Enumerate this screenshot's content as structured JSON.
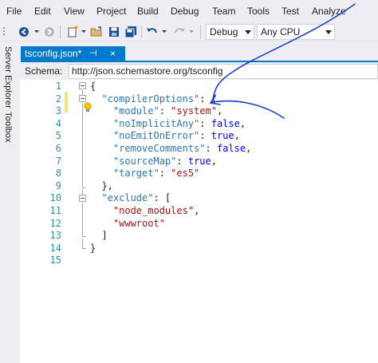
{
  "menu": [
    "File",
    "Edit",
    "View",
    "Project",
    "Build",
    "Debug",
    "Team",
    "Tools",
    "Test",
    "Analyze"
  ],
  "toolbar": {
    "config_value": "Debug",
    "platform_value": "Any CPU"
  },
  "side_tabs": [
    "Server Explorer",
    "Toolbox"
  ],
  "tab": {
    "title": "tsconfig.json*",
    "pin_glyph": "⊣",
    "close_glyph": "×"
  },
  "schema": {
    "label": "Schema:",
    "url": "http://json.schemastore.org/tsconfig"
  },
  "editor": {
    "line_numbers": [
      "1",
      "2",
      "3",
      "4",
      "5",
      "6",
      "7",
      "8",
      "9",
      "10",
      "11",
      "12",
      "13",
      "14",
      "15"
    ],
    "lines": [
      [
        {
          "t": "{",
          "c": "punc"
        }
      ],
      [
        {
          "t": "  ",
          "c": "punc"
        },
        {
          "t": "\"compilerOptions\"",
          "c": "key"
        },
        {
          "t": ": {",
          "c": "punc"
        }
      ],
      [
        {
          "t": "    ",
          "c": "punc"
        },
        {
          "t": "\"module\"",
          "c": "key"
        },
        {
          "t": ": ",
          "c": "punc"
        },
        {
          "t": "\"system\"",
          "c": "str"
        },
        {
          "t": ",",
          "c": "punc"
        }
      ],
      [
        {
          "t": "    ",
          "c": "punc"
        },
        {
          "t": "\"noImplicitAny\"",
          "c": "key"
        },
        {
          "t": ": ",
          "c": "punc"
        },
        {
          "t": "false",
          "c": "kw"
        },
        {
          "t": ",",
          "c": "punc"
        }
      ],
      [
        {
          "t": "    ",
          "c": "punc"
        },
        {
          "t": "\"noEmitOnError\"",
          "c": "key"
        },
        {
          "t": ": ",
          "c": "punc"
        },
        {
          "t": "true",
          "c": "kw"
        },
        {
          "t": ",",
          "c": "punc"
        }
      ],
      [
        {
          "t": "    ",
          "c": "punc"
        },
        {
          "t": "\"removeComments\"",
          "c": "key"
        },
        {
          "t": ": ",
          "c": "punc"
        },
        {
          "t": "false",
          "c": "kw"
        },
        {
          "t": ",",
          "c": "punc"
        }
      ],
      [
        {
          "t": "    ",
          "c": "punc"
        },
        {
          "t": "\"sourceMap\"",
          "c": "key"
        },
        {
          "t": ": ",
          "c": "punc"
        },
        {
          "t": "true",
          "c": "kw"
        },
        {
          "t": ",",
          "c": "punc"
        }
      ],
      [
        {
          "t": "    ",
          "c": "punc"
        },
        {
          "t": "\"target\"",
          "c": "key"
        },
        {
          "t": ": ",
          "c": "punc"
        },
        {
          "t": "\"es5\"",
          "c": "str"
        }
      ],
      [
        {
          "t": "  },",
          "c": "punc"
        }
      ],
      [
        {
          "t": "  ",
          "c": "punc"
        },
        {
          "t": "\"exclude\"",
          "c": "key"
        },
        {
          "t": ": [",
          "c": "punc"
        }
      ],
      [
        {
          "t": "    ",
          "c": "punc"
        },
        {
          "t": "\"node_modules\"",
          "c": "str"
        },
        {
          "t": ",",
          "c": "punc"
        }
      ],
      [
        {
          "t": "    ",
          "c": "punc"
        },
        {
          "t": "\"wwwroot\"",
          "c": "str"
        }
      ],
      [
        {
          "t": "  ]",
          "c": "punc"
        }
      ],
      [
        {
          "t": "}",
          "c": "punc"
        }
      ],
      []
    ]
  },
  "colors": {
    "accent": "#007acc",
    "chrome": "#eeeef2",
    "line_number": "#2b91af",
    "json_key": "#2e75b6",
    "json_string": "#a31515",
    "json_keyword": "#0000ff",
    "annotation_ink": "#1f3fd1"
  }
}
